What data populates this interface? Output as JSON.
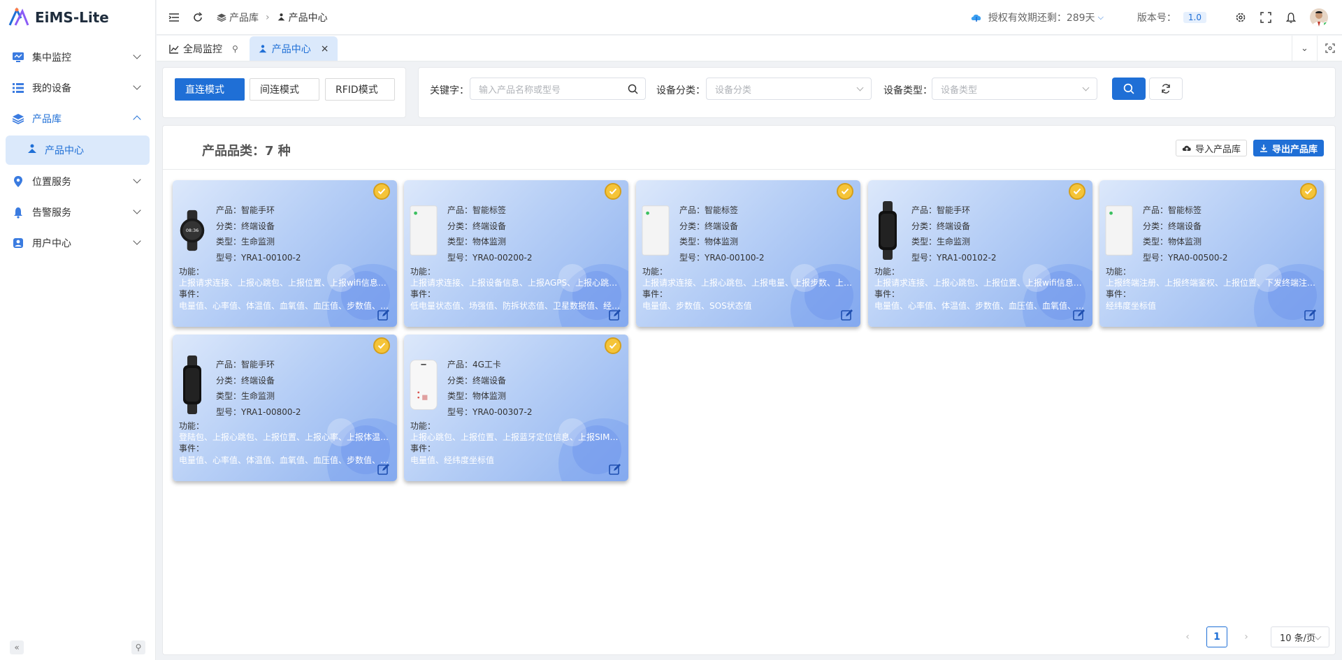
{
  "app": {
    "name": "EiMS-Lite"
  },
  "sidebar": {
    "items": [
      {
        "label": "集中监控",
        "icon": "monitor-icon"
      },
      {
        "label": "我的设备",
        "icon": "device-list-icon"
      },
      {
        "label": "产品库",
        "icon": "layers-icon"
      },
      {
        "label": "位置服务",
        "icon": "location-icon"
      },
      {
        "label": "告警服务",
        "icon": "bell-icon"
      },
      {
        "label": "用户中心",
        "icon": "user-icon"
      }
    ],
    "sub_item": {
      "label": "产品中心",
      "icon": "product-icon"
    }
  },
  "breadcrumb": {
    "parent": "产品库",
    "current": "产品中心"
  },
  "header": {
    "license": "授权有效期还剩：289天",
    "version_label": "版本号：",
    "version": "1.0"
  },
  "tabs": [
    {
      "label": "全局监控"
    },
    {
      "label": "产品中心"
    }
  ],
  "modes": {
    "direct": "直连模式",
    "indirect": "间连模式",
    "rfid": "RFID模式"
  },
  "filters": {
    "keyword_label": "关键字：",
    "keyword_placeholder": "输入产品名称或型号",
    "category_label": "设备分类：",
    "category_placeholder": "设备分类",
    "type_label": "设备类型：",
    "type_placeholder": "设备类型"
  },
  "main": {
    "count_text": "产品品类：7 种",
    "import_label": "导入产品库",
    "export_label": "导出产品库"
  },
  "field_labels": {
    "func": "功能：",
    "event": "事件："
  },
  "cards": [
    {
      "product": "产品：智能手环",
      "category": "分类：终端设备",
      "type": "类型：生命监测",
      "model": "型号：YRA1-00100-2",
      "functions": "上报请求连接、上报心跳包、上报位置、上报wifi信息…",
      "events": "电量值、心率值、体温值、血氧值、血压值、步数值、…",
      "device": "watch"
    },
    {
      "product": "产品：智能标签",
      "category": "分类：终端设备",
      "type": "类型：物体监测",
      "model": "型号：YRA0-00200-2",
      "functions": "上报请求连接、上报设备信息、上报AGPS、上报心跳…",
      "events": "低电量状态值、场强值、防拆状态值、卫星数据值、经…",
      "device": "tag"
    },
    {
      "product": "产品：智能标签",
      "category": "分类：终端设备",
      "type": "类型：物体监测",
      "model": "型号：YRA0-00100-2",
      "functions": "上报请求连接、上报心跳包、上报电量、上报步数、上…",
      "events": "电量值、步数值、SOS状态值",
      "device": "tag"
    },
    {
      "product": "产品：智能手环",
      "category": "分类：终端设备",
      "type": "类型：生命监测",
      "model": "型号：YRA1-00102-2",
      "functions": "上报请求连接、上报心跳包、上报位置、上报wifi信息…",
      "events": "电量值、心率值、体温值、步数值、血压值、血氧值、…",
      "device": "band"
    },
    {
      "product": "产品：智能标签",
      "category": "分类：终端设备",
      "type": "类型：物体监测",
      "model": "型号：YRA0-00500-2",
      "functions": "上报终端注册、上报终端鉴权、上报位置、下发终端注…",
      "events": "经纬度坐标值",
      "device": "tag"
    },
    {
      "product": "产品：智能手环",
      "category": "分类：终端设备",
      "type": "类型：生命监测",
      "model": "型号：YRA1-00800-2",
      "functions": "登陆包、上报心跳包、上报位置、上报心率、上报体温…",
      "events": "电量值、心率值、体温值、血氧值、血压值、步数值、…",
      "device": "band"
    },
    {
      "product": "产品：4G工卡",
      "category": "分类：终端设备",
      "type": "类型：物体监测",
      "model": "型号：YRA0-00307-2",
      "functions": "上报心跳包、上报位置、上报蓝牙定位信息、上报SIM…",
      "events": "电量值、经纬度坐标值",
      "device": "card"
    }
  ],
  "pagination": {
    "current": "1",
    "page_size": "10 条/页"
  },
  "colors": {
    "primary": "#1f6fd6",
    "badge": "#f5c438"
  }
}
